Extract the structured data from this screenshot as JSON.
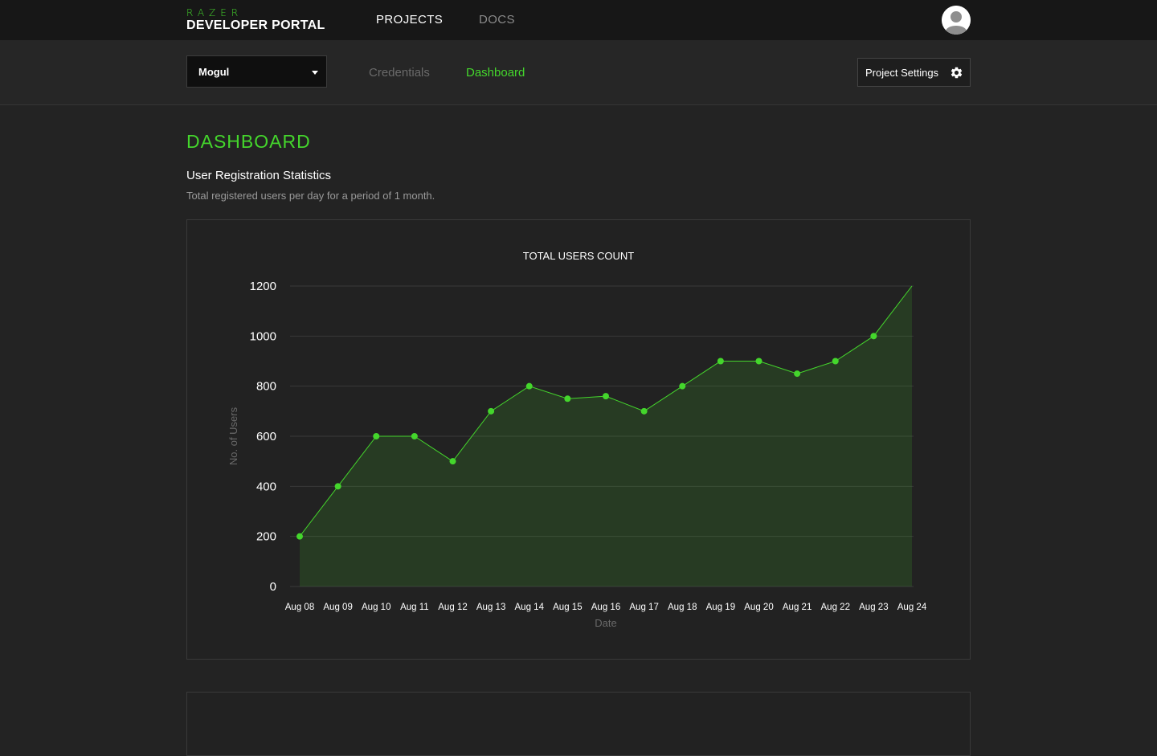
{
  "brand": {
    "razer": "RAZER",
    "portal": "DEVELOPER PORTAL"
  },
  "nav": {
    "projects": "PROJECTS",
    "docs": "DOCS"
  },
  "project": {
    "selected": "Mogul"
  },
  "tabs": {
    "credentials": "Credentials",
    "dashboard": "Dashboard"
  },
  "settings": {
    "label": "Project Settings"
  },
  "page": {
    "title": "DASHBOARD",
    "section_title": "User Registration Statistics",
    "section_desc": "Total registered users per day for a period of 1 month."
  },
  "colors": {
    "accent": "#44d62c",
    "background": "#232323",
    "topbar": "#171717"
  },
  "icons": {
    "settings": "gear-icon",
    "avatar": "user-avatar-icon",
    "dropdown": "chevron-down-icon"
  },
  "chart_data": {
    "type": "area",
    "title": "TOTAL USERS COUNT",
    "xlabel": "Date",
    "ylabel": "No. of Users",
    "categories": [
      "Aug 08",
      "Aug 09",
      "Aug 10",
      "Aug 11",
      "Aug 12",
      "Aug 13",
      "Aug 14",
      "Aug 15",
      "Aug 16",
      "Aug 17",
      "Aug 18",
      "Aug 19",
      "Aug 20",
      "Aug 21",
      "Aug 22",
      "Aug 23",
      "Aug 24"
    ],
    "values": [
      200,
      400,
      600,
      600,
      500,
      700,
      800,
      750,
      760,
      700,
      800,
      900,
      900,
      850,
      900,
      1000,
      1200
    ],
    "yticks": [
      0,
      200,
      400,
      600,
      800,
      1000,
      1200
    ],
    "ylim": [
      0,
      1200
    ],
    "grid": true,
    "legend": "none",
    "line_color": "#44d62c"
  }
}
